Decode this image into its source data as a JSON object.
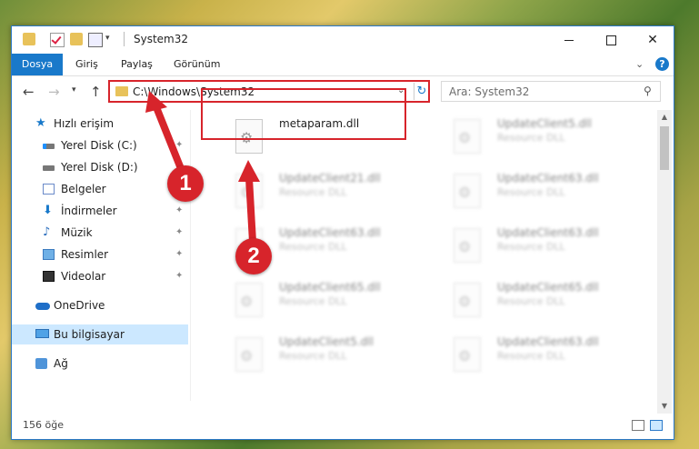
{
  "window": {
    "title": "System32",
    "controls": {
      "minimize": "—",
      "close": "✕"
    }
  },
  "ribbon": {
    "tabs": [
      "Dosya",
      "Giriş",
      "Paylaş",
      "Görünüm"
    ],
    "expand_icon": "chevron-down-icon",
    "help_icon": "?"
  },
  "nav": {
    "back": "←",
    "forward": "→",
    "recent": "▾",
    "up": "↑",
    "address": "C:\\Windows\\System32",
    "dropdown": "⌄",
    "refresh": "↻",
    "search_placeholder": "Ara: System32",
    "search_icon": "⚲"
  },
  "sidebar": {
    "items": [
      {
        "label": "Hızlı erişim",
        "icon": "star-icon",
        "pinned": false
      },
      {
        "label": "Yerel Disk (C:)",
        "icon": "drive-icon",
        "pinned": true
      },
      {
        "label": "Yerel Disk (D:)",
        "icon": "drive-icon",
        "pinned": true
      },
      {
        "label": "Belgeler",
        "icon": "document-icon",
        "pinned": true
      },
      {
        "label": "İndirmeler",
        "icon": "download-icon",
        "pinned": true
      },
      {
        "label": "Müzik",
        "icon": "music-icon",
        "pinned": true
      },
      {
        "label": "Resimler",
        "icon": "pictures-icon",
        "pinned": true
      },
      {
        "label": "Videolar",
        "icon": "video-icon",
        "pinned": true
      },
      {
        "label": "OneDrive",
        "icon": "cloud-icon",
        "pinned": false
      },
      {
        "label": "Bu bilgisayar",
        "icon": "computer-icon",
        "pinned": false,
        "selected": true
      },
      {
        "label": "Ağ",
        "icon": "network-icon",
        "pinned": false
      }
    ],
    "pin_glyph": "📌"
  },
  "files": [
    {
      "name": "metaparam.dll",
      "type": "",
      "highlighted": true
    },
    {
      "name": "UpdateClient5.dll",
      "type": "Resource DLL"
    },
    {
      "name": "UpdateClient21.dll",
      "type": "Resource DLL"
    },
    {
      "name": "UpdateClient63.dll",
      "type": "Resource DLL"
    },
    {
      "name": "UpdateClient63.dll",
      "type": "Resource DLL"
    },
    {
      "name": "UpdateClient63.dll",
      "type": "Resource DLL"
    },
    {
      "name": "UpdateClient65.dll",
      "type": "Resource DLL"
    },
    {
      "name": "UpdateClient65.dll",
      "type": "Resource DLL"
    },
    {
      "name": "UpdateClient5.dll",
      "type": "Resource DLL"
    },
    {
      "name": "UpdateClient63.dll",
      "type": "Resource DLL"
    }
  ],
  "status": {
    "item_count": "156 öğe"
  },
  "annotations": {
    "marker_1": "1",
    "marker_2": "2",
    "color": "#d7242b"
  },
  "colors": {
    "accent": "#1979ca",
    "selection": "#cce8ff",
    "highlight": "#d7242b"
  }
}
